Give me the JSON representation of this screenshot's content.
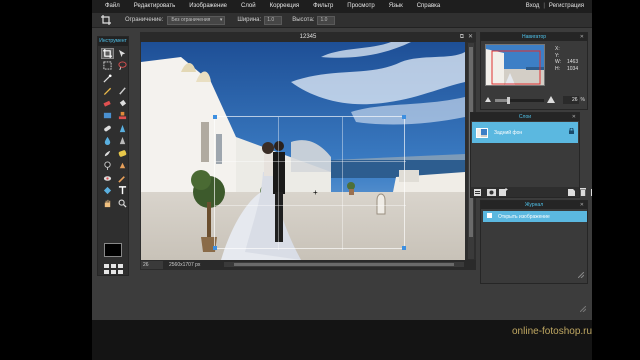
{
  "menu": {
    "items": [
      "Файл",
      "Редактировать",
      "Изображение",
      "Слой",
      "Коррекция",
      "Фильтр",
      "Просмотр",
      "Язык",
      "Справка"
    ],
    "login": "Вход",
    "separator": "|",
    "register": "Регистрация"
  },
  "options": {
    "constraint_label": "Ограничение:",
    "constraint_value": "Без ограничения",
    "width_label": "Ширина:",
    "width_value": "1.0",
    "height_label": "Высота:",
    "height_value": "1.0"
  },
  "tools": {
    "title": "Инструмент",
    "icons": [
      "crop-icon",
      "move-icon",
      "marquee-icon",
      "lasso-icon",
      "wand-icon",
      "pencil-icon",
      "brush-icon",
      "eraser-icon",
      "bucket-icon",
      "gradient-icon",
      "clone-stamp-icon",
      "healing-icon",
      "red-eye-icon",
      "spot-heal-icon",
      "blur-icon",
      "sharpen-icon",
      "smudge-icon",
      "sponge-icon",
      "dodge-icon",
      "burn-icon",
      "eye-icon",
      "eyedropper-icon",
      "colorpicker-icon",
      "text-icon",
      "hand-icon",
      "zoom-icon"
    ]
  },
  "canvas": {
    "title": "12345",
    "zoom": "26",
    "dimensions": "2560x1707 px"
  },
  "navigator": {
    "title": "Навигатор",
    "x_label": "X:",
    "x_value": "",
    "y_label": "Y:",
    "y_value": "",
    "w_label": "W:",
    "w_value": "1463",
    "h_label": "H:",
    "h_value": "1034",
    "zoom": "26",
    "zoom_unit": "%",
    "zoom_fraction": 0.26
  },
  "layers": {
    "title": "Слои",
    "items": [
      {
        "name": "Задний фон"
      }
    ]
  },
  "history": {
    "title": "Журнал",
    "items": [
      {
        "name": "Открыть изображение"
      }
    ]
  },
  "watermark": "online-fotoshop.ru",
  "colors": {
    "accent": "#4fc2ea",
    "selection": "#5bb8e0",
    "panel_bg": "#3a3a3a",
    "chrome_bg": "#1e1e1e",
    "watermark": "#c0a862"
  }
}
